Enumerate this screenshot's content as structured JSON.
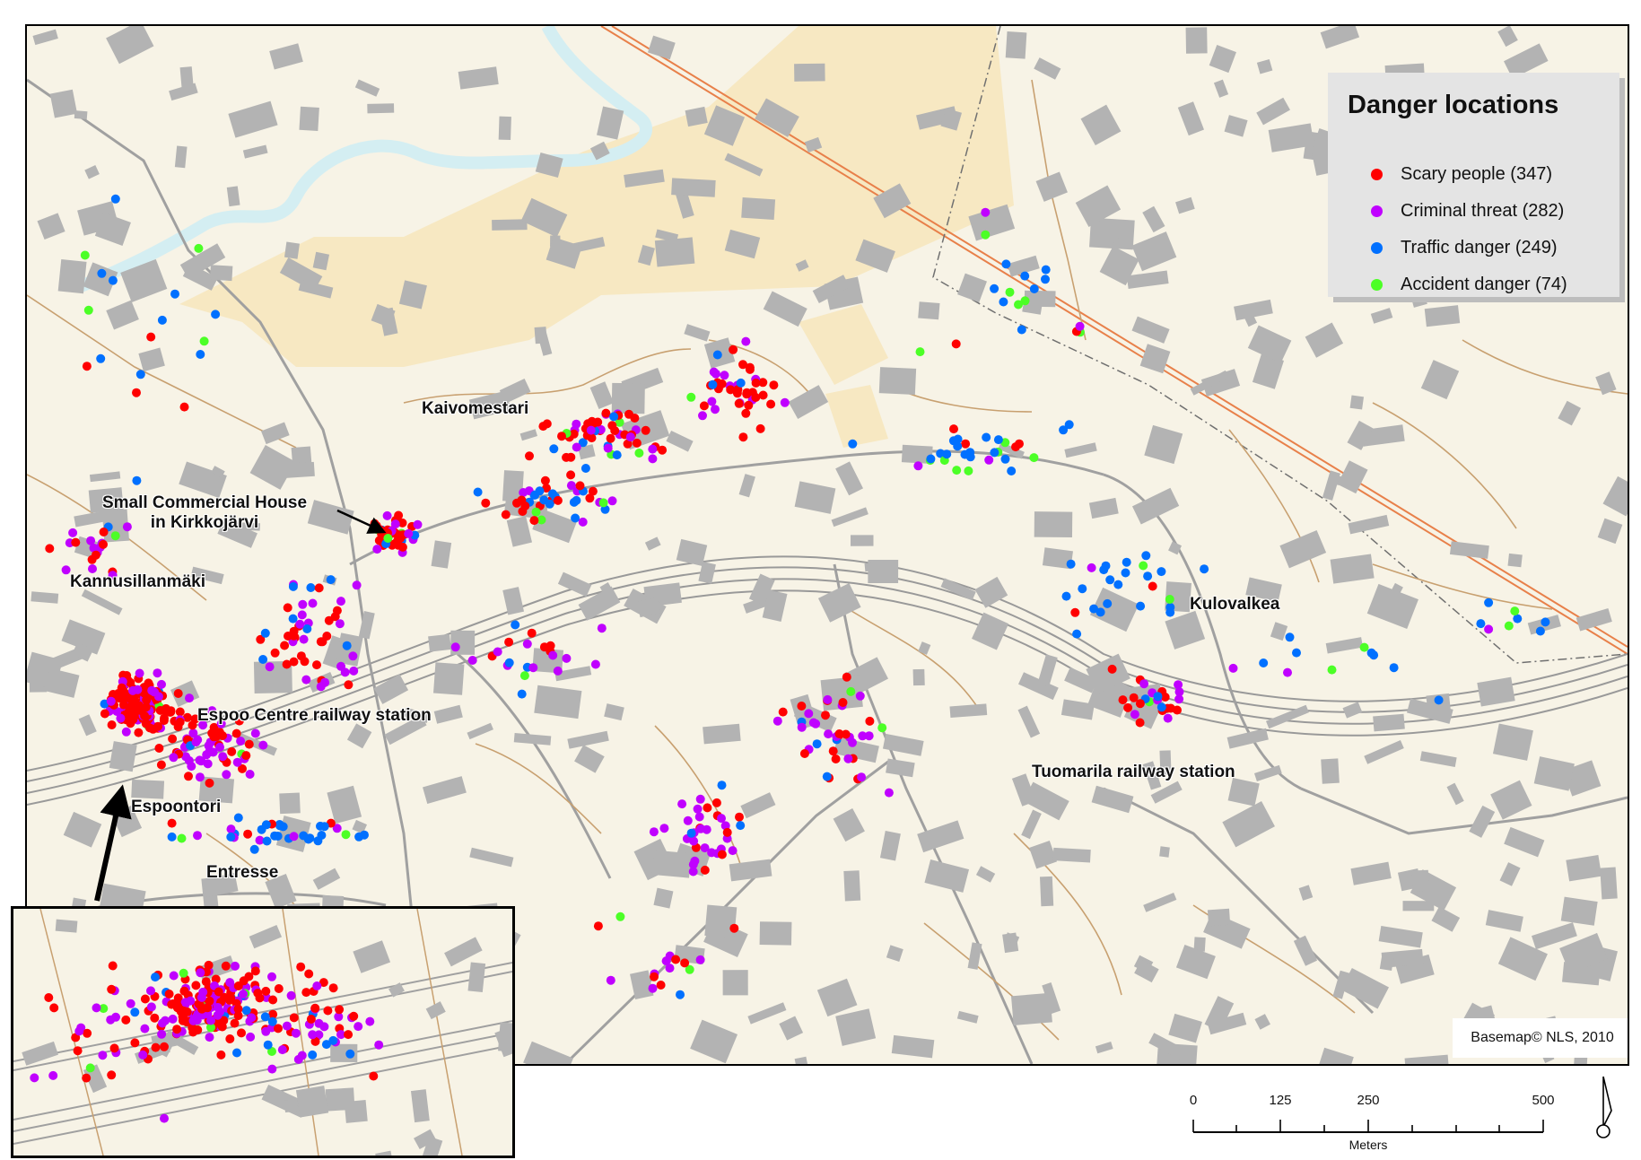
{
  "legend": {
    "title": "Danger locations",
    "items": [
      {
        "label": "Scary people  (347)",
        "color": "#ff0000",
        "category": "scary"
      },
      {
        "label": "Criminal threat  (282)",
        "color": "#c000ff",
        "category": "criminal"
      },
      {
        "label": "Traffic danger  (249)",
        "color": "#0070ff",
        "category": "traffic"
      },
      {
        "label": "Accident danger (74)",
        "color": "#4cff26",
        "category": "accident"
      }
    ]
  },
  "places": {
    "kaivomestari": "Kaivomestari",
    "small_commercial_house_1": "Small Commercial House",
    "small_commercial_house_2": "in Kirkkojärvi",
    "kannusillanmaki": "Kannusillanmäki",
    "espoo_centre_station": "Espoo Centre railway station",
    "espoontori": "Espoontori",
    "entresse": "Entresse",
    "kulovalkea": "Kulovalkea",
    "tuomarila_station": "Tuomarila railway station"
  },
  "attribution": "Basemap© NLS, 2010",
  "scale_bar": {
    "ticks": [
      "0",
      "125",
      "250",
      "500"
    ],
    "units": "Meters"
  },
  "colors": {
    "map_background": "#f7f3e6",
    "building": "#b3b3b3",
    "road_gray": "#a0a0a0",
    "path_brown": "#c8a070",
    "powerline": "#e8804a",
    "river": "#d4eef2",
    "field": "#f7e8c2"
  }
}
